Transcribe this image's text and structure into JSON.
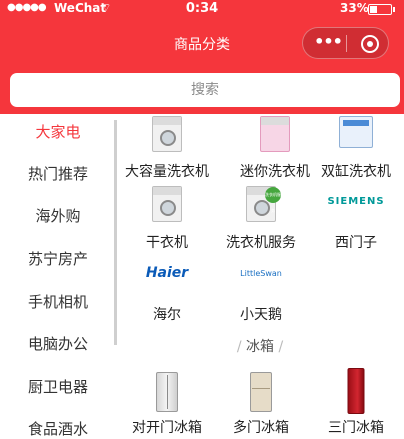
{
  "status_bar": {
    "signal": "●●●●●",
    "carrier": "WeChat",
    "wifi_icon": "wifi-icon",
    "time": "0:34",
    "battery": "33%"
  },
  "nav": {
    "title": "商品分类",
    "more_icon": "more-dots-icon",
    "close_icon": "record-close-icon",
    "more_glyph": "•••"
  },
  "search": {
    "placeholder": "搜索"
  },
  "categories": [
    "大家电",
    "热门推荐",
    "海外购",
    "苏宁房产",
    "手机相机",
    "电脑办公",
    "厨卫电器",
    "食品酒水"
  ],
  "active_category": "大家电",
  "grid": {
    "row1": [
      "大容量洗衣机",
      "迷你洗衣机",
      "双缸洗衣机"
    ],
    "row2": [
      "干衣机",
      "洗衣机服务",
      "西门子"
    ],
    "row3": [
      "海尔",
      "小天鹅"
    ],
    "row4": [
      "对开门冰箱",
      "多门冰箱",
      "三门冰箱"
    ]
  },
  "logos": {
    "siemens": "SIEMENS",
    "haier": "Haier",
    "littleswan": "LittleSwan",
    "service_badge": "洗衣机服务"
  },
  "section": {
    "title": "冰箱",
    "slash": "/"
  },
  "colors": {
    "accent": "#f5363c",
    "text": "#333333"
  }
}
